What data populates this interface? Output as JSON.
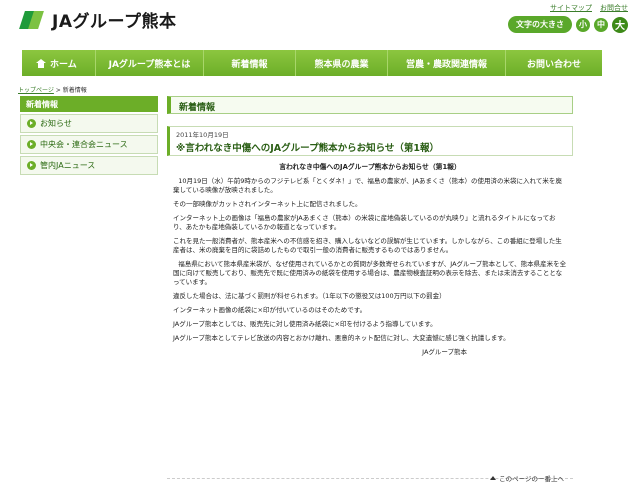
{
  "header": {
    "logo_text": "JAグループ熊本",
    "top_links": [
      "サイトマップ",
      "お問合せ"
    ],
    "font_size_label": "文字の大きさ",
    "font_sizes": [
      "小",
      "中",
      "大"
    ]
  },
  "nav": {
    "items": [
      "ホーム",
      "JAグループ熊本とは",
      "新着情報",
      "熊本県の農業",
      "営農・農政関連情報",
      "お問い合わせ"
    ]
  },
  "breadcrumb": {
    "home": "トップページ",
    "separator": " > ",
    "current": "新着情報"
  },
  "sidebar": {
    "title": "新着情報",
    "items": [
      "お知らせ",
      "中央会・連合会ニュース",
      "管内JAニュース"
    ]
  },
  "main": {
    "title": "新着情報",
    "date": "2011年10月19日",
    "article_title": "※言われなき中傷へのJAグループ熊本からお知らせ（第1報）",
    "sub_title": "言われなき中傷へのJAグループ熊本からお知らせ（第1報）",
    "paragraphs": [
      "10月19日（水）午前9時からのフジテレビ系「とくダネ！」で、福島の農家が、JAあまくさ（熊本）の使用済の米袋に入れて米を廃棄している映像が放映されました。",
      "その一部映像がカットされインターネット上に配信されました。",
      "インターネット上の画像は「福島の農家がJAあまくさ（熊本）の米袋に産地偽装しているのが丸映り」と流れるタイトルになっており、あたかも産地偽装しているかの報道となっています。",
      "これを見た一般消費者が、熊本産米への不信感を招き、購入しないなどの誤解が生じています。しかしながら、この番組に登場した生産者は、米の廃棄を目的に袋詰めしたもので取引一般の消費者に販売するものではありません。",
      "福島県において熊本県産米袋が、なぜ使用されているかとの質問が多数寄せられていますが、JAグループ熊本として、熊本県産米を全国に向けて販売しており、販売先で既に使用済みの紙袋を使用する場合は、農産物検査証明の表示を除去、または未消去することとなっています。",
      "違反した場合は、法に基づく罰則が科せられます。（1年以下の懲役又は100万円以下の罰金）",
      "インターネット画像の紙袋に×印が付いているのはそのためです。",
      "JAグループ熊本としては、販売先に対し使用済み紙袋に×印を付けるよう指導しています。",
      "JAグループ熊本としてテレビ放送の内容とおかけ離れ、悪意的ネット配信に対し、大変遺憾に感じ強く抗議します。"
    ],
    "signature": "JAグループ熊本",
    "page_top": "このページの一番上へ"
  },
  "colors": {
    "brand_green": "#6cae28",
    "nav_green": "#8cc63f",
    "dark_green": "#2a5e14"
  }
}
